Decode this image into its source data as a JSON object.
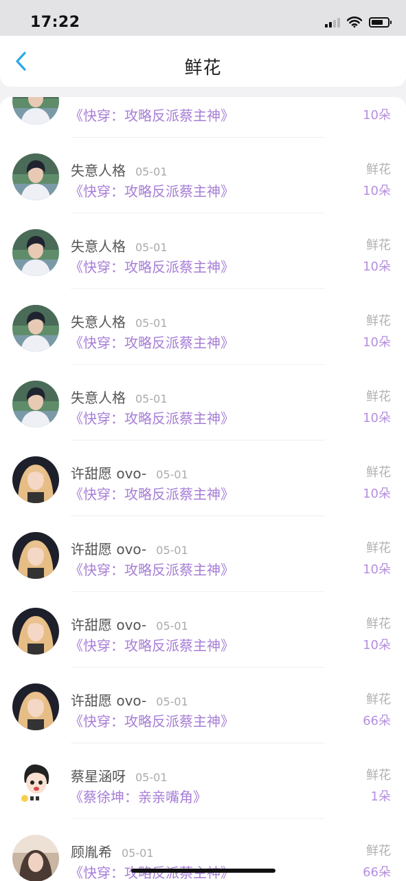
{
  "status_bar": {
    "time": "17:22"
  },
  "header": {
    "title": "鲜花"
  },
  "icons": {
    "back": "chevron-left-icon"
  },
  "colors": {
    "accent_blue": "#2aa7e8",
    "book_purple": "#a77ed6",
    "count_purple": "#b58ee0",
    "muted_gray": "#b0b0b0"
  },
  "items": [
    {
      "avatar": "user-a",
      "name": "",
      "date": "",
      "book": "《快穿：攻略反派蔡主神》",
      "type": "",
      "count": "10朵"
    },
    {
      "avatar": "user-a",
      "name": "失意人格",
      "date": "05-01",
      "book": "《快穿：攻略反派蔡主神》",
      "type": "鲜花",
      "count": "10朵"
    },
    {
      "avatar": "user-a",
      "name": "失意人格",
      "date": "05-01",
      "book": "《快穿：攻略反派蔡主神》",
      "type": "鲜花",
      "count": "10朵"
    },
    {
      "avatar": "user-a",
      "name": "失意人格",
      "date": "05-01",
      "book": "《快穿：攻略反派蔡主神》",
      "type": "鲜花",
      "count": "10朵"
    },
    {
      "avatar": "user-a",
      "name": "失意人格",
      "date": "05-01",
      "book": "《快穿：攻略反派蔡主神》",
      "type": "鲜花",
      "count": "10朵"
    },
    {
      "avatar": "user-b",
      "name": "许甜愿 ovo-",
      "date": "05-01",
      "book": "《快穿：攻略反派蔡主神》",
      "type": "鲜花",
      "count": "10朵"
    },
    {
      "avatar": "user-b",
      "name": "许甜愿 ovo-",
      "date": "05-01",
      "book": "《快穿：攻略反派蔡主神》",
      "type": "鲜花",
      "count": "10朵"
    },
    {
      "avatar": "user-b",
      "name": "许甜愿 ovo-",
      "date": "05-01",
      "book": "《快穿：攻略反派蔡主神》",
      "type": "鲜花",
      "count": "10朵"
    },
    {
      "avatar": "user-b",
      "name": "许甜愿 ovo-",
      "date": "05-01",
      "book": "《快穿：攻略反派蔡主神》",
      "type": "鲜花",
      "count": "66朵"
    },
    {
      "avatar": "user-c",
      "name": "蔡星涵呀",
      "date": "05-01",
      "book": "《蔡徐坤：亲亲嘴角》",
      "type": "鲜花",
      "count": "1朵"
    },
    {
      "avatar": "user-d",
      "name": "顾胤希",
      "date": "05-01",
      "book": "《快穿：攻略反派蔡主神》",
      "type": "鲜花",
      "count": "66朵"
    }
  ]
}
